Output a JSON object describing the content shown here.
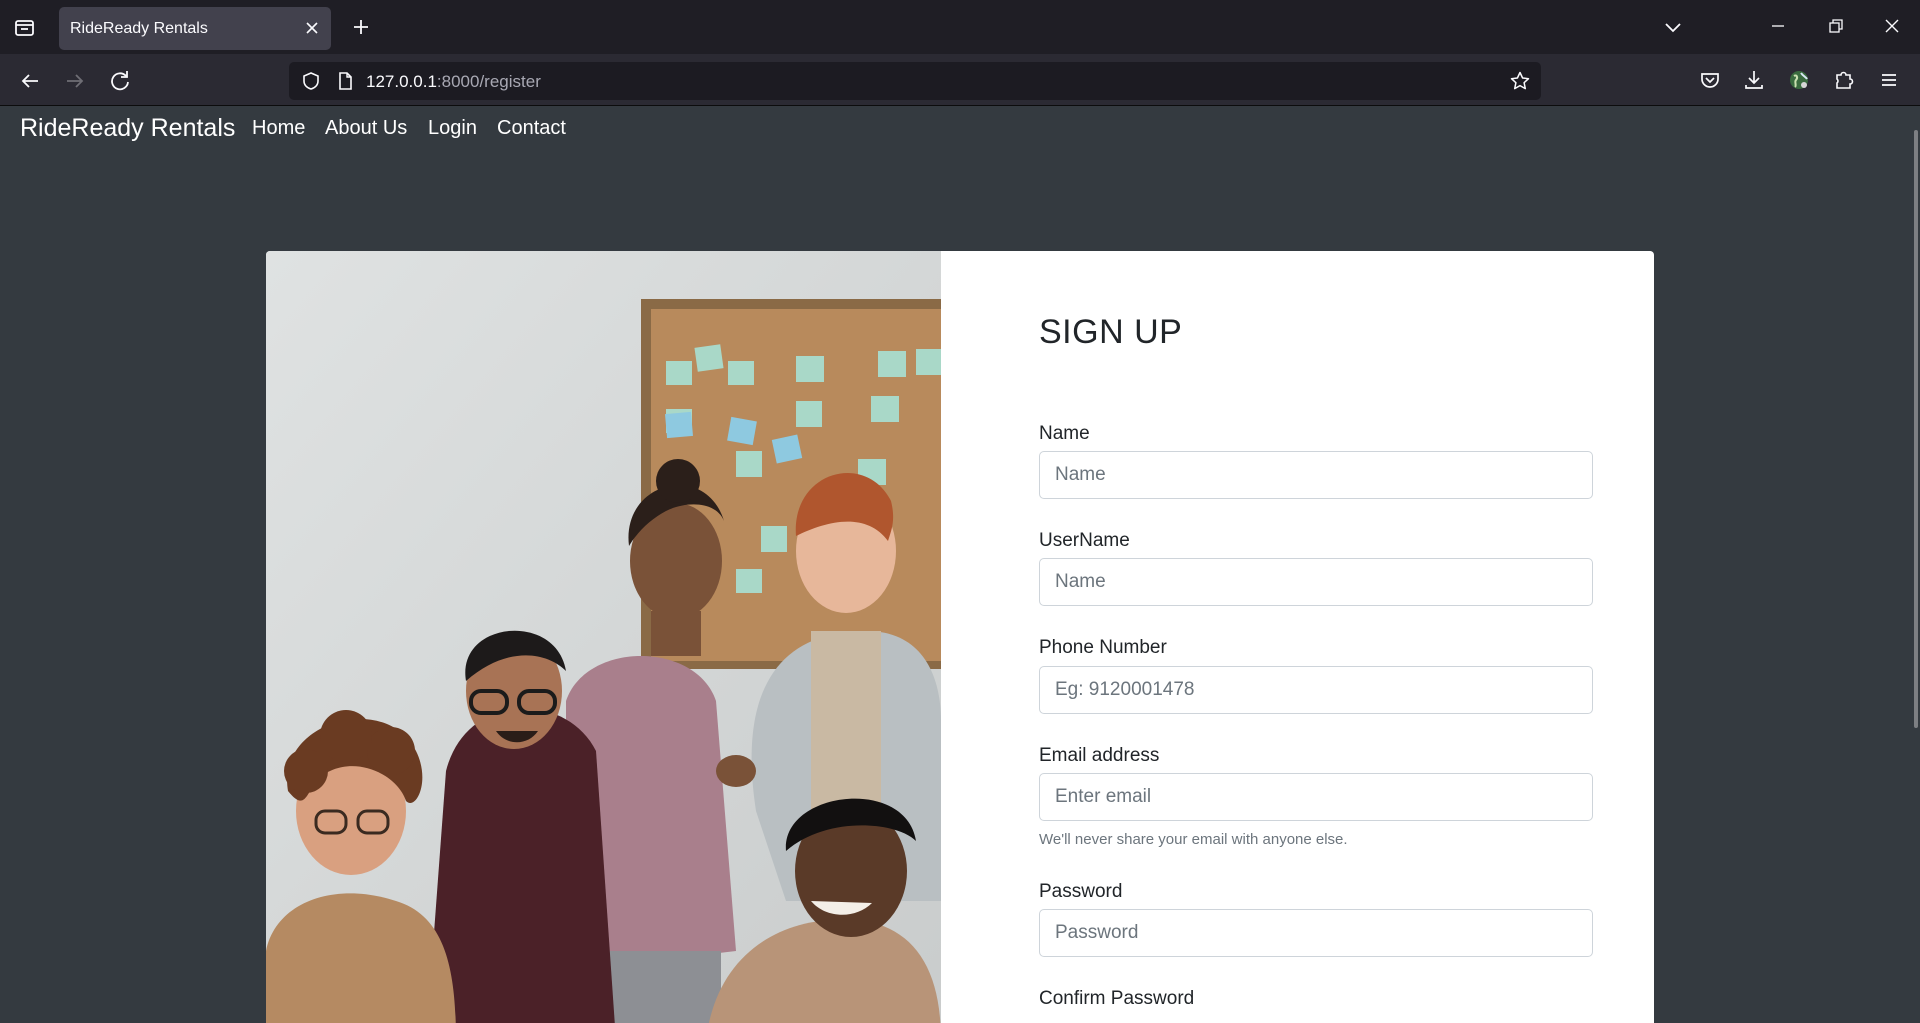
{
  "browser": {
    "tab_title": "RideReady Rentals",
    "url_host": "127.0.0.1",
    "url_path": ":8000/register"
  },
  "site": {
    "brand": "RideReady Rentals",
    "nav_links": [
      "Home",
      "About Us",
      "Login",
      "Contact"
    ]
  },
  "form": {
    "title": "SIGN UP",
    "fields": {
      "name": {
        "label": "Name",
        "placeholder": "Name"
      },
      "username": {
        "label": "UserName",
        "placeholder": "Name"
      },
      "phone": {
        "label": "Phone Number",
        "placeholder": "Eg: 9120001478"
      },
      "email": {
        "label": "Email address",
        "placeholder": "Enter email",
        "help": "We'll never share your email with anyone else."
      },
      "password": {
        "label": "Password",
        "placeholder": "Password"
      },
      "confirm_password": {
        "label": "Confirm Password"
      }
    }
  },
  "icons": {
    "tab_list": "tab-list-icon",
    "close_tab": "close-icon",
    "new_tab": "plus-icon",
    "back": "arrow-left-icon",
    "forward": "arrow-right-icon",
    "reload": "reload-icon",
    "shield": "shield-icon",
    "page": "page-icon",
    "bookmark": "star-icon",
    "pocket": "pocket-icon",
    "downloads": "download-icon",
    "account": "globe-avatar-icon",
    "extensions": "puzzle-icon",
    "menu": "hamburger-icon"
  },
  "colors": {
    "page_bg": "#343a40",
    "card_bg": "#ffffff",
    "chrome_dark": "#1f1e25",
    "toolbar": "#2b2a33"
  }
}
